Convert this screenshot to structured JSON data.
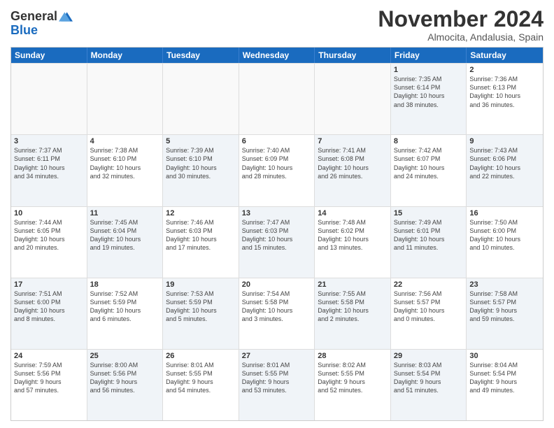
{
  "logo": {
    "line1": "General",
    "line2": "Blue"
  },
  "title": "November 2024",
  "location": "Almocita, Andalusia, Spain",
  "days_of_week": [
    "Sunday",
    "Monday",
    "Tuesday",
    "Wednesday",
    "Thursday",
    "Friday",
    "Saturday"
  ],
  "weeks": [
    [
      {
        "day": "",
        "text": "",
        "empty": true
      },
      {
        "day": "",
        "text": "",
        "empty": true
      },
      {
        "day": "",
        "text": "",
        "empty": true
      },
      {
        "day": "",
        "text": "",
        "empty": true
      },
      {
        "day": "",
        "text": "",
        "empty": true
      },
      {
        "day": "1",
        "text": "Sunrise: 7:35 AM\nSunset: 6:14 PM\nDaylight: 10 hours\nand 38 minutes.",
        "shaded": true
      },
      {
        "day": "2",
        "text": "Sunrise: 7:36 AM\nSunset: 6:13 PM\nDaylight: 10 hours\nand 36 minutes.",
        "shaded": false
      }
    ],
    [
      {
        "day": "3",
        "text": "Sunrise: 7:37 AM\nSunset: 6:11 PM\nDaylight: 10 hours\nand 34 minutes.",
        "shaded": true
      },
      {
        "day": "4",
        "text": "Sunrise: 7:38 AM\nSunset: 6:10 PM\nDaylight: 10 hours\nand 32 minutes.",
        "shaded": false
      },
      {
        "day": "5",
        "text": "Sunrise: 7:39 AM\nSunset: 6:10 PM\nDaylight: 10 hours\nand 30 minutes.",
        "shaded": true
      },
      {
        "day": "6",
        "text": "Sunrise: 7:40 AM\nSunset: 6:09 PM\nDaylight: 10 hours\nand 28 minutes.",
        "shaded": false
      },
      {
        "day": "7",
        "text": "Sunrise: 7:41 AM\nSunset: 6:08 PM\nDaylight: 10 hours\nand 26 minutes.",
        "shaded": true
      },
      {
        "day": "8",
        "text": "Sunrise: 7:42 AM\nSunset: 6:07 PM\nDaylight: 10 hours\nand 24 minutes.",
        "shaded": false
      },
      {
        "day": "9",
        "text": "Sunrise: 7:43 AM\nSunset: 6:06 PM\nDaylight: 10 hours\nand 22 minutes.",
        "shaded": true
      }
    ],
    [
      {
        "day": "10",
        "text": "Sunrise: 7:44 AM\nSunset: 6:05 PM\nDaylight: 10 hours\nand 20 minutes.",
        "shaded": false
      },
      {
        "day": "11",
        "text": "Sunrise: 7:45 AM\nSunset: 6:04 PM\nDaylight: 10 hours\nand 19 minutes.",
        "shaded": true
      },
      {
        "day": "12",
        "text": "Sunrise: 7:46 AM\nSunset: 6:03 PM\nDaylight: 10 hours\nand 17 minutes.",
        "shaded": false
      },
      {
        "day": "13",
        "text": "Sunrise: 7:47 AM\nSunset: 6:03 PM\nDaylight: 10 hours\nand 15 minutes.",
        "shaded": true
      },
      {
        "day": "14",
        "text": "Sunrise: 7:48 AM\nSunset: 6:02 PM\nDaylight: 10 hours\nand 13 minutes.",
        "shaded": false
      },
      {
        "day": "15",
        "text": "Sunrise: 7:49 AM\nSunset: 6:01 PM\nDaylight: 10 hours\nand 11 minutes.",
        "shaded": true
      },
      {
        "day": "16",
        "text": "Sunrise: 7:50 AM\nSunset: 6:00 PM\nDaylight: 10 hours\nand 10 minutes.",
        "shaded": false
      }
    ],
    [
      {
        "day": "17",
        "text": "Sunrise: 7:51 AM\nSunset: 6:00 PM\nDaylight: 10 hours\nand 8 minutes.",
        "shaded": true
      },
      {
        "day": "18",
        "text": "Sunrise: 7:52 AM\nSunset: 5:59 PM\nDaylight: 10 hours\nand 6 minutes.",
        "shaded": false
      },
      {
        "day": "19",
        "text": "Sunrise: 7:53 AM\nSunset: 5:59 PM\nDaylight: 10 hours\nand 5 minutes.",
        "shaded": true
      },
      {
        "day": "20",
        "text": "Sunrise: 7:54 AM\nSunset: 5:58 PM\nDaylight: 10 hours\nand 3 minutes.",
        "shaded": false
      },
      {
        "day": "21",
        "text": "Sunrise: 7:55 AM\nSunset: 5:58 PM\nDaylight: 10 hours\nand 2 minutes.",
        "shaded": true
      },
      {
        "day": "22",
        "text": "Sunrise: 7:56 AM\nSunset: 5:57 PM\nDaylight: 10 hours\nand 0 minutes.",
        "shaded": false
      },
      {
        "day": "23",
        "text": "Sunrise: 7:58 AM\nSunset: 5:57 PM\nDaylight: 9 hours\nand 59 minutes.",
        "shaded": true
      }
    ],
    [
      {
        "day": "24",
        "text": "Sunrise: 7:59 AM\nSunset: 5:56 PM\nDaylight: 9 hours\nand 57 minutes.",
        "shaded": false
      },
      {
        "day": "25",
        "text": "Sunrise: 8:00 AM\nSunset: 5:56 PM\nDaylight: 9 hours\nand 56 minutes.",
        "shaded": true
      },
      {
        "day": "26",
        "text": "Sunrise: 8:01 AM\nSunset: 5:55 PM\nDaylight: 9 hours\nand 54 minutes.",
        "shaded": false
      },
      {
        "day": "27",
        "text": "Sunrise: 8:01 AM\nSunset: 5:55 PM\nDaylight: 9 hours\nand 53 minutes.",
        "shaded": true
      },
      {
        "day": "28",
        "text": "Sunrise: 8:02 AM\nSunset: 5:55 PM\nDaylight: 9 hours\nand 52 minutes.",
        "shaded": false
      },
      {
        "day": "29",
        "text": "Sunrise: 8:03 AM\nSunset: 5:54 PM\nDaylight: 9 hours\nand 51 minutes.",
        "shaded": true
      },
      {
        "day": "30",
        "text": "Sunrise: 8:04 AM\nSunset: 5:54 PM\nDaylight: 9 hours\nand 49 minutes.",
        "shaded": false
      }
    ]
  ]
}
